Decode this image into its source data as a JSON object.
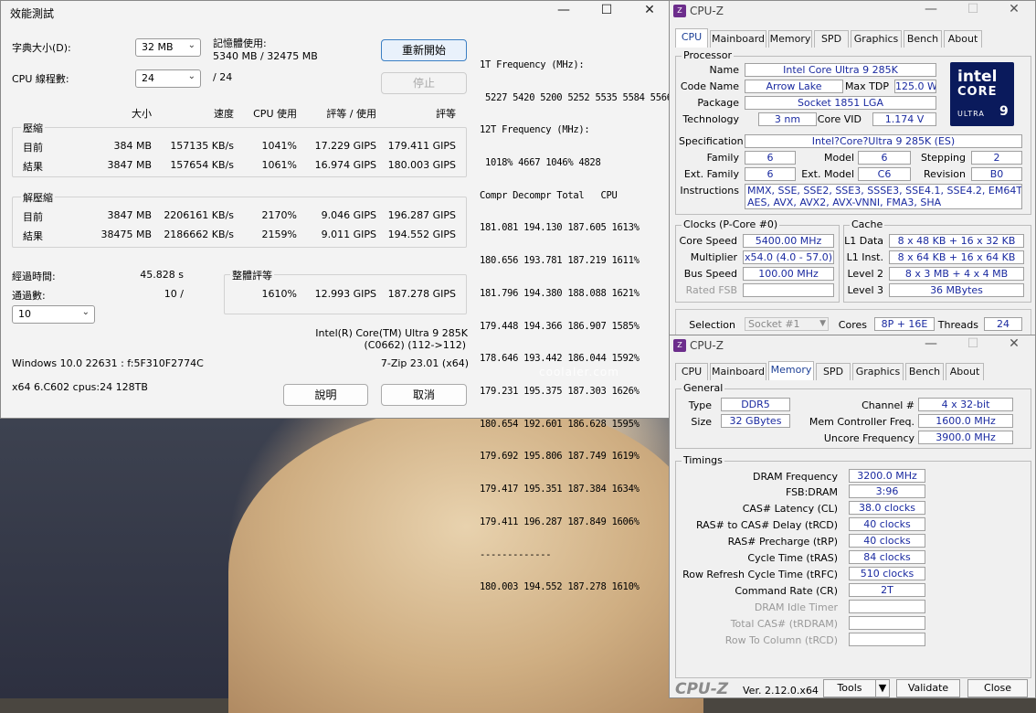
{
  "zip": {
    "title": "效能測試",
    "dict_label": "字典大小(D):",
    "dict_value": "32 MB",
    "threads_label": "CPU 線程數:",
    "threads_value": "24",
    "threads_max": "/ 24",
    "mem_label": "記憶體使用:",
    "mem_value": "5340 MB / 32475 MB",
    "restart_btn": "重新開始",
    "stop_btn": "停止",
    "col_size": "大小",
    "col_speed": "速度",
    "col_cpu": "CPU 使用",
    "col_rating_use": "評等 / 使用",
    "col_rating": "評等",
    "compress_label": "壓縮",
    "decompress_label": "解壓縮",
    "compress": [
      {
        "label": "目前",
        "size": "384 MB",
        "speed": "157135 KB/s",
        "cpu": "1041%",
        "ru": "17.229 GIPS",
        "r": "179.411 GIPS"
      },
      {
        "label": "結果",
        "size": "3847 MB",
        "speed": "157654 KB/s",
        "cpu": "1061%",
        "ru": "16.974 GIPS",
        "r": "180.003 GIPS"
      }
    ],
    "decompress": [
      {
        "label": "目前",
        "size": "3847 MB",
        "speed": "2206161 KB/s",
        "cpu": "2170%",
        "ru": "9.046 GIPS",
        "r": "196.287 GIPS"
      },
      {
        "label": "結果",
        "size": "38475 MB",
        "speed": "2186662 KB/s",
        "cpu": "2159%",
        "ru": "9.011 GIPS",
        "r": "194.552 GIPS"
      }
    ],
    "elapsed_label": "經過時間:",
    "elapsed_value": "45.828 s",
    "passes_label": "通過數:",
    "passes_value": "10 /",
    "passes_combo": "10",
    "overall_label": "整體評等",
    "overall_cpu": "1610%",
    "overall_ru": "12.993 GIPS",
    "overall_r": "187.278 GIPS",
    "cpu_name": "Intel(R) Core(TM) Ultra 9 285K",
    "cpu_code": "(C0662) (112->112)",
    "os": "Windows 10.0 22631 : f:5F310F2774C",
    "zipver": "7-Zip 23.01 (x64)",
    "arch": "x64 6.C602 cpus:24 128TB",
    "help_btn": "說明",
    "cancel_btn": "取消",
    "log": [
      "1T Frequency (MHz):",
      " 5227 5420 5200 5252 5535 5584 5566",
      "12T Frequency (MHz):",
      " 1018% 4667 1046% 4828",
      "Compr Decompr Total   CPU",
      "181.081 194.130 187.605 1613%",
      "180.656 193.781 187.219 1611%",
      "181.796 194.380 188.088 1621%",
      "179.448 194.366 186.907 1585%",
      "178.646 193.442 186.044 1592%",
      "179.231 195.375 187.303 1626%",
      "180.654 192.601 186.628 1595%",
      "179.692 195.806 187.749 1619%",
      "179.417 195.351 187.384 1634%",
      "179.411 196.287 187.849 1606%",
      "-------------",
      "180.003 194.552 187.278 1610%"
    ]
  },
  "watermark": "coolaler.com",
  "cpuz1": {
    "title": "CPU-Z",
    "tabs": [
      "CPU",
      "Mainboard",
      "Memory",
      "SPD",
      "Graphics",
      "Bench",
      "About"
    ],
    "processor_group": "Processor",
    "name_label": "Name",
    "name": "Intel Core Ultra 9 285K",
    "codename_label": "Code Name",
    "codename": "Arrow Lake",
    "maxtdp_label": "Max TDP",
    "maxtdp": "125.0 W",
    "package_label": "Package",
    "package": "Socket 1851 LGA",
    "tech_label": "Technology",
    "tech": "3 nm",
    "vid_label": "Core VID",
    "vid": "1.174 V",
    "spec_label": "Specification",
    "spec": "Intel?Core?Ultra 9 285K (ES)",
    "family_label": "Family",
    "family": "6",
    "model_label": "Model",
    "model": "6",
    "stepping_label": "Stepping",
    "stepping": "2",
    "extfam_label": "Ext. Family",
    "extfam": "6",
    "extmod_label": "Ext. Model",
    "extmod": "C6",
    "rev_label": "Revision",
    "rev": "B0",
    "instr_label": "Instructions",
    "instr1": "MMX, SSE, SSE2, SSE3, SSSE3, SSE4.1, SSE4.2, EM64T, VT-x,",
    "instr2": "AES, AVX, AVX2, AVX-VNNI, FMA3, SHA",
    "logo_l1": "intel",
    "logo_l2": "CORE",
    "logo_l3": "ULTRA",
    "logo_l4": "9",
    "clocks_group": "Clocks (P-Core #0)",
    "corespeed_label": "Core Speed",
    "corespeed": "5400.00 MHz",
    "mult_label": "Multiplier",
    "mult": "x54.0 (4.0 - 57.0)",
    "bus_label": "Bus Speed",
    "bus": "100.00 MHz",
    "fsb_label": "Rated FSB",
    "fsb": "",
    "cache_group": "Cache",
    "l1d_label": "L1 Data",
    "l1d": "8 x 48 KB + 16 x 32 KB",
    "l1i_label": "L1 Inst.",
    "l1i": "8 x 64 KB + 16 x 64 KB",
    "l2_label": "Level 2",
    "l2": "8 x 3 MB + 4 x 4 MB",
    "l3_label": "Level 3",
    "l3": "36 MBytes",
    "sel_label": "Selection",
    "sel": "Socket #1",
    "cores_label": "Cores",
    "cores": "8P + 16E",
    "threads_label": "Threads",
    "threads": "24"
  },
  "cpuz2": {
    "title": "CPU-Z",
    "tabs": [
      "CPU",
      "Mainboard",
      "Memory",
      "SPD",
      "Graphics",
      "Bench",
      "About"
    ],
    "general_group": "General",
    "type_label": "Type",
    "type": "DDR5",
    "channel_label": "Channel #",
    "channel": "4 x 32-bit",
    "size_label": "Size",
    "size": "32 GBytes",
    "mcf_label": "Mem Controller Freq.",
    "mcf": "1600.0 MHz",
    "uncore_label": "Uncore Frequency",
    "uncore": "3900.0 MHz",
    "timings_group": "Timings",
    "timings": [
      {
        "label": "DRAM Frequency",
        "value": "3200.0 MHz"
      },
      {
        "label": "FSB:DRAM",
        "value": "3:96"
      },
      {
        "label": "CAS# Latency (CL)",
        "value": "38.0 clocks"
      },
      {
        "label": "RAS# to CAS# Delay (tRCD)",
        "value": "40 clocks"
      },
      {
        "label": "RAS# Precharge (tRP)",
        "value": "40 clocks"
      },
      {
        "label": "Cycle Time (tRAS)",
        "value": "84 clocks"
      },
      {
        "label": "Row Refresh Cycle Time (tRFC)",
        "value": "510 clocks"
      },
      {
        "label": "Command Rate (CR)",
        "value": "2T"
      },
      {
        "label": "DRAM Idle Timer",
        "value": ""
      },
      {
        "label": "Total CAS# (tRDRAM)",
        "value": ""
      },
      {
        "label": "Row To Column (tRCD)",
        "value": ""
      }
    ],
    "brand": "CPU-Z",
    "version": "Ver. 2.12.0.x64",
    "tools_btn": "Tools",
    "validate_btn": "Validate",
    "close_btn": "Close"
  }
}
